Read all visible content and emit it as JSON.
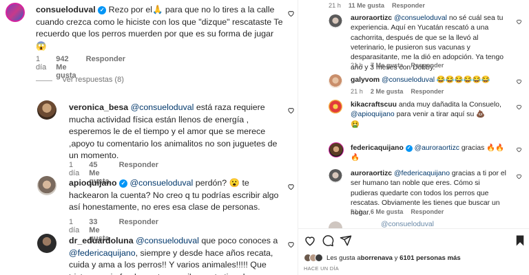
{
  "left": {
    "comment1": {
      "username": "consueloduval",
      "text_prefix": " Rezo por el",
      "emoji1": "🙏",
      "text_suffix": " para que no lo tires a la calle cuando crezca como le hiciste con los que \"dizque\" rescataste Te recuerdo que los perros muerden por que es su forma de jugar",
      "emoji2": "😱",
      "time": "1 día",
      "likes": "942 Me gusta",
      "reply": "Responder"
    },
    "view_replies": "Ver respuestas (8)",
    "comment2": {
      "username": "veronica_besa",
      "mention": "@consueloduval",
      "text": " está raza requiere mucha actividad física están llenos de energía , esperemos le de el tiempo y el amor que se merece ,apoyo tu comentario los animalitos no son juguetes de un momento.",
      "time": "1 día",
      "likes": "45 Me gusta",
      "reply": "Responder"
    },
    "comment3": {
      "username": "apioquijano",
      "mention": "@consueloduval",
      "text1": " perdón? ",
      "emoji": "😮",
      "text2": " te hackearon la cuenta? No creo q tu podrías escribir algo así honestamente, no eres esa clase de personas.",
      "time": "1 día",
      "likes": "33 Me gusta",
      "reply": "Responder"
    },
    "comment4": {
      "username": "dr_eduardoluna",
      "mention1": "@consueloduval",
      "text1": " que poco conoces a ",
      "mention2": "@federicaquijano",
      "text2": ", siempre y desde hace años recata, cuida y ama a los perros!! Y varios animales!!!!! Que triste que sin fundamentos escribas este tipo de"
    }
  },
  "right": {
    "top_meta": {
      "time": "21 h",
      "likes": "11 Me gusta",
      "reply": "Responder"
    },
    "comment1": {
      "username": "auroraortizc",
      "mention": "@consueloduval",
      "text": " no sé cuál sea tu experiencia. Aquí en Yucatán rescató a una cachorrita, después de que se la llevó al veterinario, le pusieron sus vacunas y desparasitante, me la dió en adopción. Ya tengo año y 3 meses con Dobby.",
      "time": "21 h",
      "likes": "7 Me gusta",
      "reply": "Responder"
    },
    "comment2": {
      "username": "galyvom",
      "mention": "@consueloduval",
      "emojis": "😂😂😂😂😂😂",
      "time": "21 h",
      "likes": "2 Me gusta",
      "reply": "Responder"
    },
    "comment3": {
      "username": "kikacraftscuu",
      "text1": " anda muy dañadita la Consuelo, ",
      "mention": "@apioquijano",
      "text2": " para venir a tirar aquí su ",
      "emoji1": "💩",
      "emoji2": "🤮"
    },
    "comment4": {
      "username": "federicaquijano",
      "mention": "@auroraortizc",
      "text": " gracias ",
      "emojis": "🔥🔥🔥"
    },
    "comment5": {
      "username": "auroraortizc",
      "mention": "@federicaquijano",
      "text": " gracias a ti por el ser humano tan noble que eres. Cómo si pudieras quedarte con todos los perros que rescatas. Obviamente les tienes que buscar un hogar.",
      "time": "21 h",
      "likes": "6 Me gusta",
      "reply": "Responder"
    },
    "partial_mention": "@consueloduval",
    "likes_line_prefix": "Les gusta a ",
    "likes_user": "borrenava",
    "likes_mid": " y ",
    "likes_count": "6101 personas más",
    "posted": "HACE UN DÍA"
  }
}
